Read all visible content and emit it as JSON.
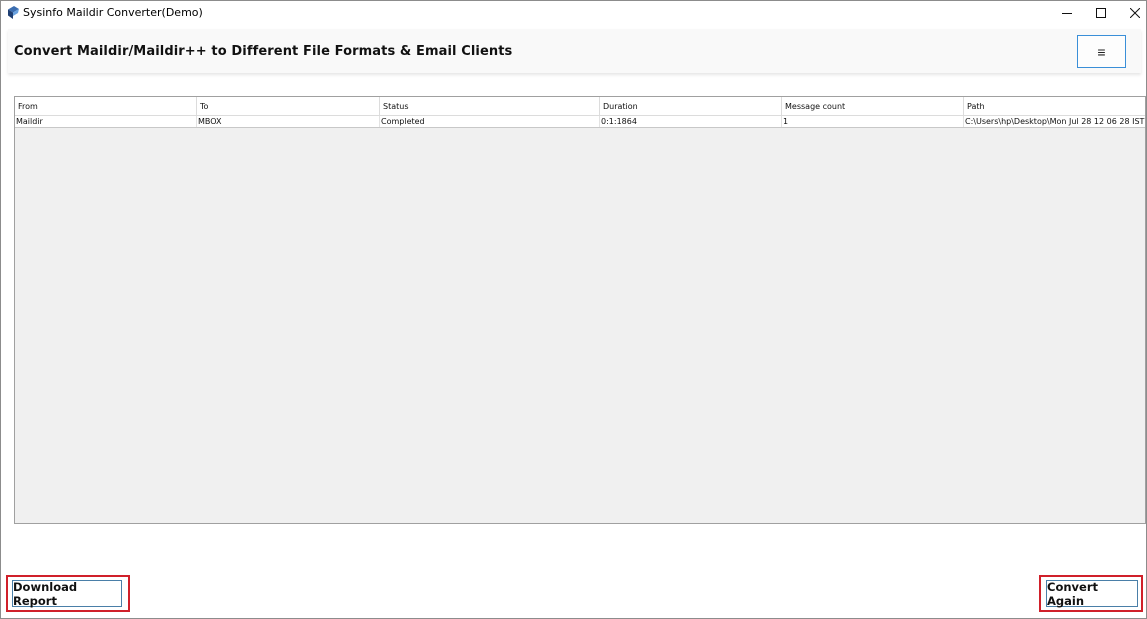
{
  "window": {
    "title": "Sysinfo Maildir Converter(Demo)"
  },
  "header": {
    "title": "Convert Maildir/Maildir++ to Different File Formats & Email Clients",
    "menu_icon": "hamburger-icon"
  },
  "table": {
    "columns": [
      "From",
      "To",
      "Status",
      "Duration",
      "Message count",
      "Path"
    ],
    "rows": [
      [
        "Maildir",
        "MBOX",
        "Completed",
        "0:1:1864",
        "1",
        "C:\\Users\\hp\\Desktop\\Mon Jul 28 12 06 28 IST ..."
      ]
    ]
  },
  "footer": {
    "download_label": "Download Report",
    "convert_label": "Convert Again"
  },
  "colors": {
    "highlight": "#d0202a",
    "menu_border": "#3a8fd8",
    "grid_bg": "#f0f0f0"
  }
}
